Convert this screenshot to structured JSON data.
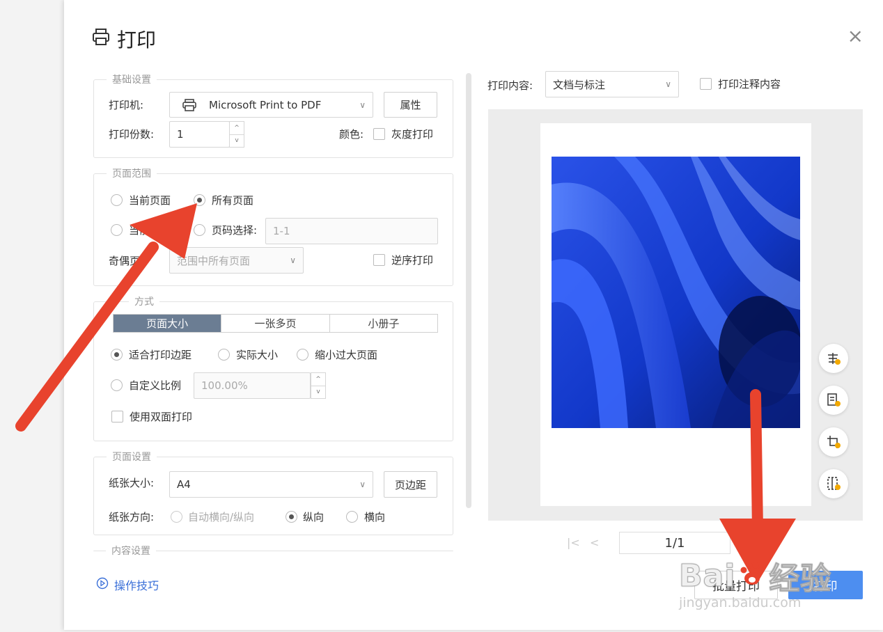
{
  "dialog": {
    "title": "打印",
    "close": "×"
  },
  "basic": {
    "legend": "基础设置",
    "printer_label": "打印机:",
    "printer_value": "Microsoft Print to PDF",
    "properties_button": "属性",
    "copies_label": "打印份数:",
    "copies_value": "1",
    "color_label": "颜色:",
    "grayscale_label": "灰度打印"
  },
  "range": {
    "legend": "页面范围",
    "current_page": "当前页面",
    "all_pages": "所有页面",
    "current_partial": "当前",
    "page_select_label": "页码选择:",
    "page_select_placeholder": "1-1",
    "odd_even_label": "奇偶页",
    "odd_even_value": "范围中所有页面",
    "reverse_label": "逆序打印"
  },
  "mode": {
    "legend": "方式",
    "tabs": [
      "页面大小",
      "一张多页",
      "小册子"
    ],
    "fit_margins": "适合打印边距",
    "actual_size": "实际大小",
    "shrink_large": "缩小过大页面",
    "custom_scale": "自定义比例",
    "custom_scale_value": "100.00%",
    "duplex": "使用双面打印"
  },
  "page_setup": {
    "legend": "页面设置",
    "paper_size_label": "纸张大小:",
    "paper_size_value": "A4",
    "margins_button": "页边距",
    "orientation_label": "纸张方向:",
    "auto_orientation": "自动横向/纵向",
    "portrait": "纵向",
    "landscape": "横向"
  },
  "content_settings": {
    "legend": "内容设置"
  },
  "preview": {
    "content_label": "打印内容:",
    "content_value": "文档与标注",
    "annotations_label": "打印注释内容",
    "page_indicator": "1/1",
    "first": "|<",
    "prev": "<"
  },
  "footer": {
    "tips": "操作技巧",
    "batch_print": "批量打印",
    "print": "打印"
  },
  "watermark": {
    "brand": "Bai",
    "brand_cn": "经验",
    "url": "jingyan.baidu.com"
  },
  "colors": {
    "accent": "#4d8ef0",
    "arrow": "#e8432d",
    "tab_active": "#6b7d93"
  }
}
